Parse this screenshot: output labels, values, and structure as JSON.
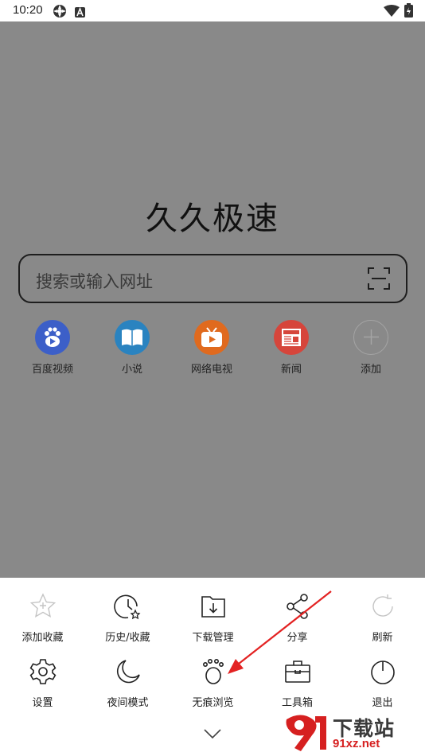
{
  "status_bar": {
    "time": "10:20",
    "icons": [
      "gear-status-icon",
      "a-badge-icon",
      "wifi-icon",
      "battery-icon"
    ]
  },
  "home": {
    "brand_title": "久久极速",
    "search": {
      "placeholder": "搜索或输入网址",
      "scan_icon": "scan-icon"
    },
    "shortcuts": [
      {
        "label": "百度视频",
        "icon": "baidu-video-icon",
        "color": "#3c5fc8"
      },
      {
        "label": "小说",
        "icon": "book-icon",
        "color": "#2a83c0"
      },
      {
        "label": "网络电视",
        "icon": "tv-icon",
        "color": "#e06a1e"
      },
      {
        "label": "新闻",
        "icon": "news-icon",
        "color": "#d6453b"
      },
      {
        "label": "添加",
        "icon": "plus-icon",
        "color": "#9e9e9e"
      }
    ]
  },
  "menu": {
    "row1": [
      {
        "label": "添加收藏",
        "icon": "star-add-icon",
        "disabled": true
      },
      {
        "label": "历史/收藏",
        "icon": "history-clock-icon",
        "disabled": false
      },
      {
        "label": "下载管理",
        "icon": "download-folder-icon",
        "disabled": false
      },
      {
        "label": "分享",
        "icon": "share-icon",
        "disabled": false
      },
      {
        "label": "刷新",
        "icon": "refresh-icon",
        "disabled": true
      }
    ],
    "row2": [
      {
        "label": "设置",
        "icon": "settings-gear-icon",
        "disabled": false
      },
      {
        "label": "夜间模式",
        "icon": "moon-icon",
        "disabled": false
      },
      {
        "label": "无痕浏览",
        "icon": "paw-icon",
        "disabled": false
      },
      {
        "label": "工具箱",
        "icon": "toolbox-icon",
        "disabled": false
      },
      {
        "label": "退出",
        "icon": "power-icon",
        "disabled": false
      }
    ],
    "collapse_icon": "chevron-down-icon"
  },
  "watermark": {
    "line1": "下载站",
    "line2": "91xz.net",
    "logo_color": "#d62020"
  }
}
